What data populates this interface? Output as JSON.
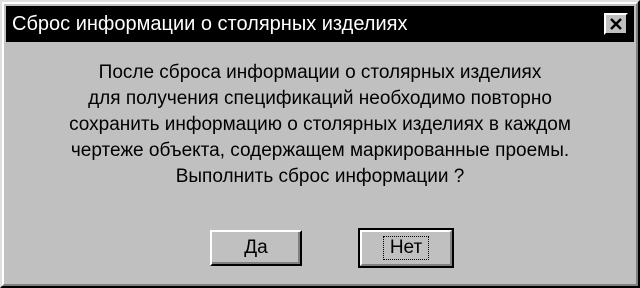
{
  "dialog": {
    "title": "Сброс информации о столярных изделиях",
    "close_icon": "close-icon",
    "message_lines": [
      "После сброса информации о столярных изделиях",
      "для получения спецификаций необходимо повторно",
      "сохранить информацию о столярных изделиях в каждом",
      "чертеже объекта, содержащем маркированные проемы.",
      "Выполнить сброс информации ?"
    ],
    "yes_label": "Да",
    "no_label": "Нет"
  }
}
